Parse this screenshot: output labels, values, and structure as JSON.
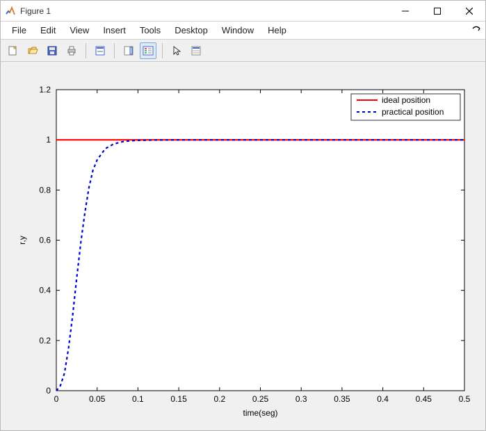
{
  "window": {
    "title": "Figure 1",
    "controls": {
      "min": "–",
      "max": "☐",
      "close": "✕"
    }
  },
  "menu": {
    "items": [
      "File",
      "Edit",
      "View",
      "Insert",
      "Tools",
      "Desktop",
      "Window",
      "Help"
    ]
  },
  "toolbar": {
    "items": [
      {
        "name": "new-figure-icon",
        "title": "New Figure"
      },
      {
        "name": "open-icon",
        "title": "Open"
      },
      {
        "name": "save-icon",
        "title": "Save"
      },
      {
        "name": "print-icon",
        "title": "Print"
      },
      {
        "name": "sep"
      },
      {
        "name": "link-plot-icon",
        "title": "Link Plot"
      },
      {
        "name": "sep"
      },
      {
        "name": "insert-colorbar-icon",
        "title": "Insert Colorbar"
      },
      {
        "name": "insert-legend-icon",
        "title": "Insert Legend",
        "active": true
      },
      {
        "name": "sep"
      },
      {
        "name": "cursor-icon",
        "title": "Edit Plot"
      },
      {
        "name": "open-property-inspector-icon",
        "title": "Property Inspector"
      }
    ]
  },
  "chart_data": {
    "type": "line",
    "xlabel": "time(seg)",
    "ylabel": "r,y",
    "xlim": [
      0,
      0.5
    ],
    "ylim": [
      0,
      1.2
    ],
    "xticks": [
      0,
      0.05,
      0.1,
      0.15,
      0.2,
      0.25,
      0.3,
      0.35,
      0.4,
      0.45,
      0.5
    ],
    "yticks": [
      0,
      0.2,
      0.4,
      0.6,
      0.8,
      1,
      1.2
    ],
    "legend": {
      "entries": [
        "ideal position",
        "practical position"
      ],
      "position": "top-right"
    },
    "series": [
      {
        "name": "ideal position",
        "style": "solid",
        "color": "#ff0000",
        "x": [
          0,
          0.5
        ],
        "y": [
          1,
          1
        ]
      },
      {
        "name": "practical position",
        "style": "dashed",
        "color": "#0000cd",
        "x": [
          0,
          0.005,
          0.01,
          0.015,
          0.02,
          0.025,
          0.03,
          0.035,
          0.04,
          0.045,
          0.05,
          0.06,
          0.07,
          0.08,
          0.09,
          0.1,
          0.12,
          0.15,
          0.2,
          0.3,
          0.4,
          0.5
        ],
        "y": [
          0,
          0.02,
          0.07,
          0.17,
          0.3,
          0.45,
          0.59,
          0.71,
          0.81,
          0.88,
          0.92,
          0.965,
          0.983,
          0.992,
          0.996,
          0.998,
          0.9993,
          0.9999,
          1.0,
          1.0,
          1.0,
          1.0
        ]
      }
    ]
  }
}
